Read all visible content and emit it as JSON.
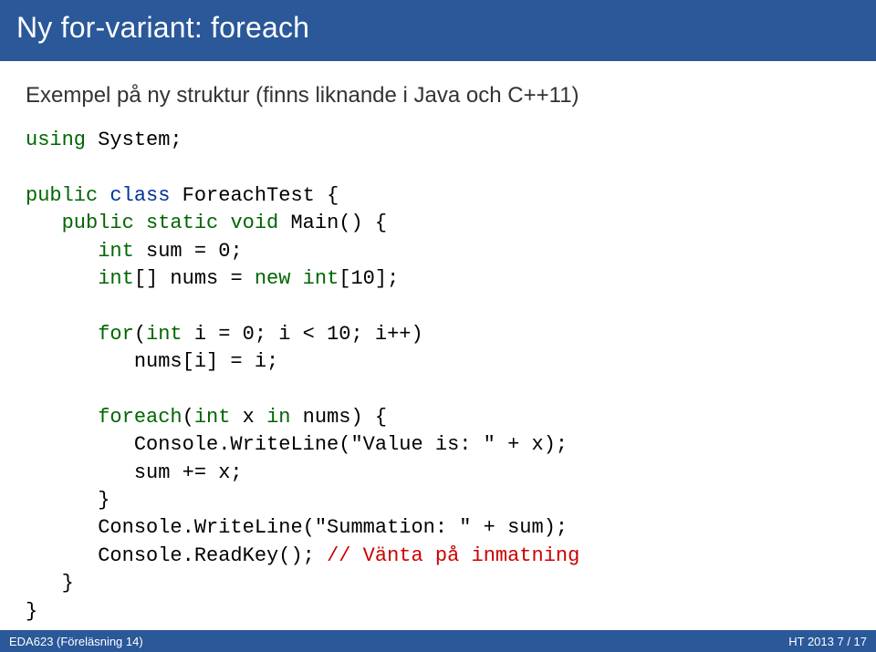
{
  "slide": {
    "title": "Ny for-variant: foreach",
    "intro": "Exempel på ny struktur (finns liknande i Java och C++11)",
    "code": {
      "l1a": "using",
      "l1b": " System;",
      "l3a": "public",
      "l3b": " class",
      "l3c": " ForeachTest {",
      "l4a": "   public",
      "l4b": " static",
      "l4c": " void",
      "l4d": " Main() {",
      "l5a": "      int",
      "l5b": " sum = 0;",
      "l6a": "      int",
      "l6b": "[] nums = ",
      "l6c": "new",
      "l6d": " int",
      "l6e": "[10];",
      "l8a": "      for",
      "l8b": "(",
      "l8c": "int",
      "l8d": " i = 0; i < 10; i++)",
      "l9": "         nums[i] = i;",
      "l11a": "      foreach",
      "l11b": "(",
      "l11c": "int",
      "l11d": " x ",
      "l11e": "in",
      "l11f": " nums) {",
      "l12": "         Console.WriteLine(\"Value is: \" + x);",
      "l13": "         sum += x;",
      "l14": "      }",
      "l15": "      Console.WriteLine(\"Summation: \" + sum);",
      "l16a": "      Console.ReadKey(); ",
      "l16b": "// Vänta på inmatning",
      "l17": "   }",
      "l18": "}"
    },
    "footer": {
      "left": "EDA623 (Föreläsning 14)",
      "center": "",
      "right": "HT 2013    7 / 17"
    }
  }
}
